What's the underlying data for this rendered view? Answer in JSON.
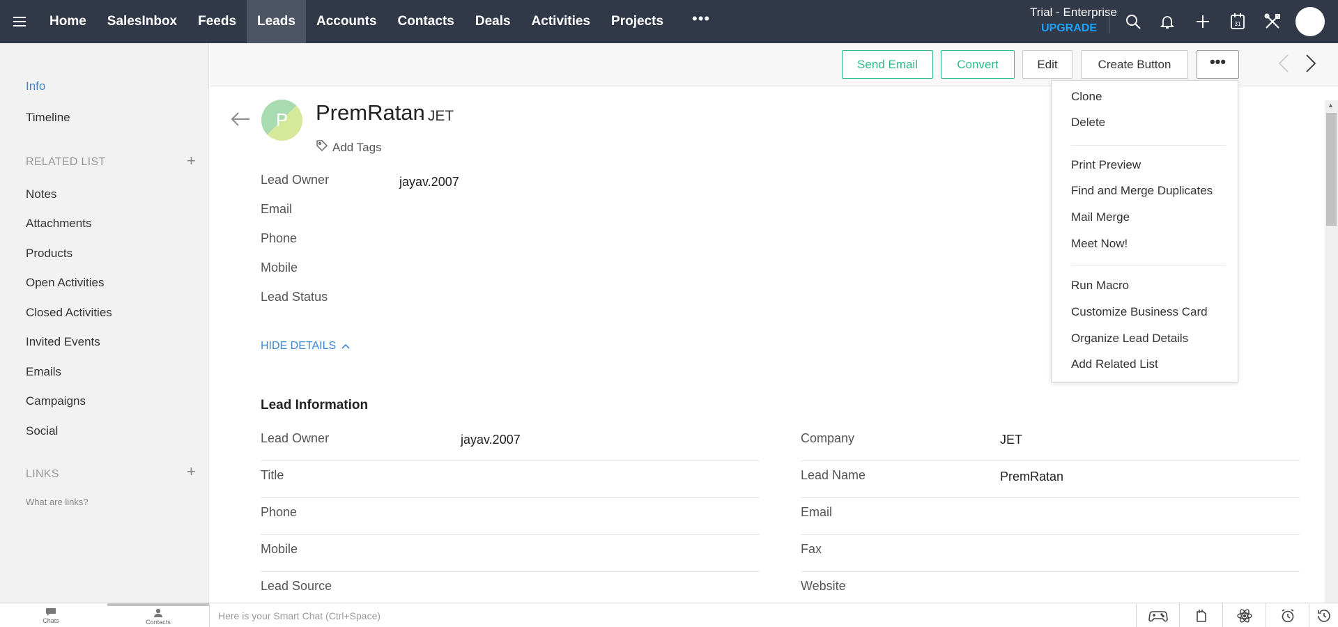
{
  "nav": {
    "items": [
      "Home",
      "SalesInbox",
      "Feeds",
      "Leads",
      "Accounts",
      "Contacts",
      "Deals",
      "Activities",
      "Projects"
    ],
    "more": "•••",
    "trial_label": "Trial - Enterprise",
    "upgrade_label": "UPGRADE",
    "icons": [
      "search-icon",
      "bell-icon",
      "plus-icon",
      "calendar-icon",
      "tools-icon"
    ],
    "calendar_day": "31"
  },
  "sidebar": {
    "info": "Info",
    "timeline": "Timeline",
    "related_heading": "RELATED LIST",
    "related_items": [
      "Notes",
      "Attachments",
      "Products",
      "Open Activities",
      "Closed Activities",
      "Invited Events",
      "Emails",
      "Campaigns",
      "Social"
    ],
    "links_heading": "LINKS",
    "links_help": "What are links?",
    "plus": "+"
  },
  "actions": {
    "send_email": "Send Email",
    "convert": "Convert",
    "edit": "Edit",
    "create_button": "Create Button",
    "more": "•••"
  },
  "dropdown": {
    "group1": [
      "Clone",
      "Delete"
    ],
    "group2": [
      "Print Preview",
      "Find and Merge Duplicates",
      "Mail Merge",
      "Meet Now!"
    ],
    "group3": [
      "Run Macro",
      "Customize Business Card",
      "Organize Lead Details",
      "Add Related List"
    ]
  },
  "lead": {
    "initial": "P",
    "name": "PremRatan",
    "company_suffix": "- JET",
    "add_tags": "Add Tags",
    "summary": [
      {
        "label": "Lead Owner",
        "value": "jayav.2007"
      },
      {
        "label": "Email",
        "value": ""
      },
      {
        "label": "Phone",
        "value": ""
      },
      {
        "label": "Mobile",
        "value": ""
      },
      {
        "label": "Lead Status",
        "value": ""
      }
    ],
    "hide_details": "HIDE DETAILS",
    "section_title": "Lead Information",
    "left_fields": [
      {
        "label": "Lead Owner",
        "value": "jayav.2007"
      },
      {
        "label": "Title",
        "value": ""
      },
      {
        "label": "Phone",
        "value": ""
      },
      {
        "label": "Mobile",
        "value": ""
      },
      {
        "label": "Lead Source",
        "value": ""
      }
    ],
    "right_fields": [
      {
        "label": "Company",
        "value": "JET"
      },
      {
        "label": "Lead Name",
        "value": "PremRatan"
      },
      {
        "label": "Email",
        "value": ""
      },
      {
        "label": "Fax",
        "value": ""
      },
      {
        "label": "Website",
        "value": ""
      }
    ]
  },
  "bottom": {
    "chats": "Chats",
    "contacts": "Contacts",
    "smartchat_placeholder": "Here is your Smart Chat (Ctrl+Space)"
  }
}
